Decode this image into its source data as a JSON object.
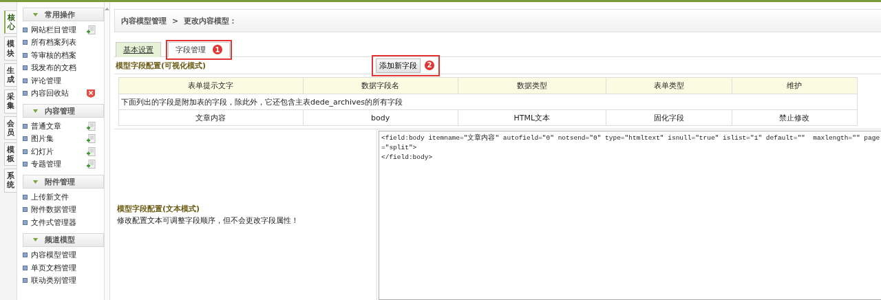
{
  "side_tabs": [
    {
      "label": "核心",
      "selected": true
    },
    {
      "label": "模块",
      "selected": false
    },
    {
      "label": "生成",
      "selected": false
    },
    {
      "label": "采集",
      "selected": false
    },
    {
      "label": "会员",
      "selected": false
    },
    {
      "label": "模板",
      "selected": false
    },
    {
      "label": "系统",
      "selected": false
    }
  ],
  "sidebar": {
    "sections": [
      {
        "title": "常用操作",
        "items": [
          {
            "label": "网站栏目管理",
            "kind": "add"
          },
          {
            "label": "所有档案列表",
            "kind": "plain"
          },
          {
            "label": "等审核的档案",
            "kind": "plain"
          },
          {
            "label": "我发布的文档",
            "kind": "plain"
          },
          {
            "label": "评论管理",
            "kind": "plain"
          },
          {
            "label": "内容回收站",
            "kind": "delete"
          }
        ]
      },
      {
        "title": "内容管理",
        "items": [
          {
            "label": "普通文章",
            "kind": "add"
          },
          {
            "label": "图片集",
            "kind": "add"
          },
          {
            "label": "幻灯片",
            "kind": "add"
          },
          {
            "label": "专题管理",
            "kind": "add"
          }
        ]
      },
      {
        "title": "附件管理",
        "items": [
          {
            "label": "上传新文件",
            "kind": "plain"
          },
          {
            "label": "附件数据管理",
            "kind": "plain"
          },
          {
            "label": "文件式管理器",
            "kind": "plain"
          }
        ]
      },
      {
        "title": "频道模型",
        "items": [
          {
            "label": "内容模型管理",
            "kind": "plain"
          },
          {
            "label": "单页文档管理",
            "kind": "plain"
          },
          {
            "label": "联动类别管理",
            "kind": "plain"
          }
        ]
      }
    ]
  },
  "breadcrumb": {
    "items": [
      "内容模型管理",
      "更改内容模型："
    ],
    "separator": ">"
  },
  "tabs": [
    {
      "label": "基本设置",
      "selected": false
    },
    {
      "label": "字段管理",
      "selected": true,
      "callout": "1"
    }
  ],
  "visual": {
    "title": "模型字段配置(可视化模式)",
    "add_button": {
      "label": "添加新字段",
      "callout": "2"
    }
  },
  "table": {
    "columns": [
      "表单提示文字",
      "数据字段名",
      "数据类型",
      "表单类型",
      "维护"
    ],
    "note": "下面列出的字段是附加表的字段，除此外，它还包含主表dede_archives的所有字段",
    "rows": [
      [
        "文章内容",
        "body",
        "HTML文本",
        "固化字段",
        "禁止修改"
      ]
    ]
  },
  "text_mode": {
    "title": "模型字段配置(文本模式)",
    "description": "修改配置文本可调整字段顺序，但不会更改字段属性！",
    "value": "<field:body itemname=\"文章内容\" autofield=\"0\" notsend=\"0\" type=\"htmltext\" isnull=\"true\" islist=\"1\" default=\"\"  maxlength=\"\" page\n=\"split\">\n</field:body>"
  }
}
